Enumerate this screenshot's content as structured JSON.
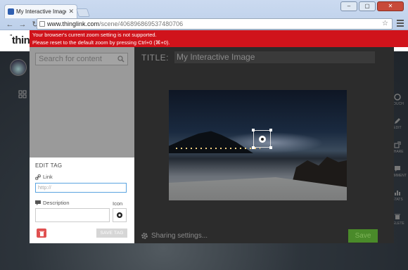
{
  "browser": {
    "tab_title": "My Interactive Image - Th",
    "url_host": "www.thinglink.com",
    "url_path": "/scene/406896869537480706",
    "window_buttons": [
      "–",
      "▢",
      "✕"
    ]
  },
  "page": {
    "logo": "thing",
    "logo_prefix": "\"",
    "error_line1": "Your browser's current zoom setting is not supported.",
    "error_line2": "Please reset to the default zoom by pressing Ctrl+0 (⌘+0)."
  },
  "editor": {
    "search_placeholder": "Search for content",
    "edit_tag_title": "EDIT TAG",
    "link_label": "Link",
    "link_placeholder": "http://",
    "description_label": "Description",
    "icon_label": "Icon",
    "save_tag_label": "SAVE TAG",
    "title_label": "TITLE:",
    "title_value": "My Interactive Image",
    "sharing_label": "Sharing settings...",
    "save_label": "Save"
  },
  "toolbar": {
    "items": [
      "TOUCH",
      "EDIT",
      "SHARE",
      "COMMENT",
      "STATS",
      "DELETE"
    ]
  },
  "colors": {
    "error_red": "#d0131b",
    "save_green": "#4a8a2a",
    "delete_red": "#e05050"
  }
}
